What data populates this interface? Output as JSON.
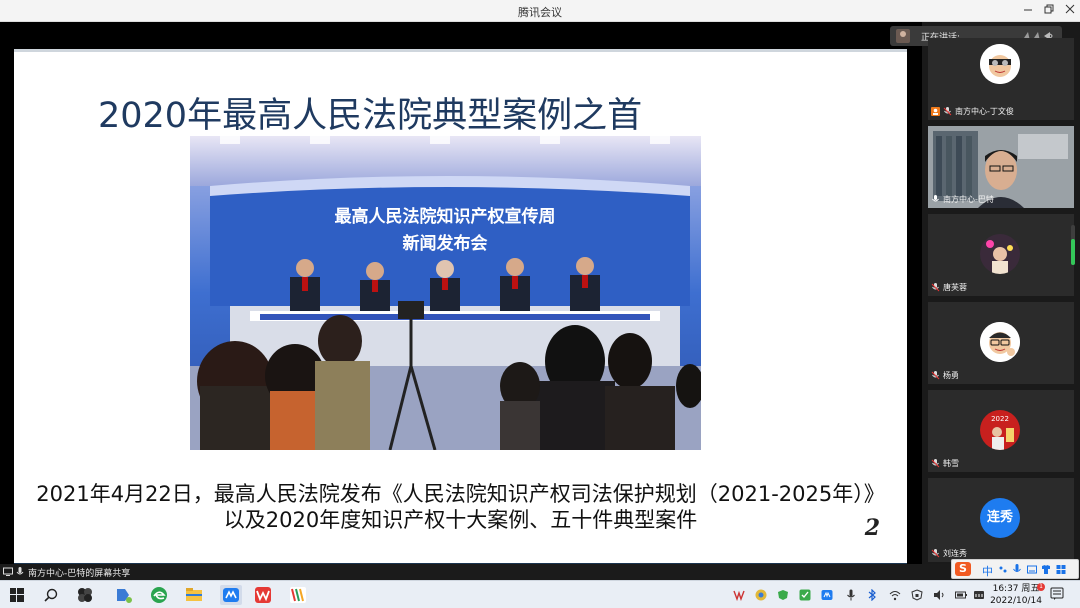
{
  "window": {
    "title": "腾讯会议"
  },
  "slide": {
    "title": "2020年最高人民法院典型案例之首",
    "photo_banner_line1": "最高人民法院知识产权宣传周",
    "photo_banner_line2": "新闻发布会",
    "caption_line1": "2021年4月22日，最高人民法院发布《人民法院知识产权司法保护规划（2021-2025年）》",
    "caption_line2": "以及2020年度知识产权十大案例、五十件典型案件",
    "page_number": "2"
  },
  "speaking": {
    "label": "正在讲话:"
  },
  "participants": [
    {
      "name": "南方中心-丁文俊",
      "avatar": "cartoon-face"
    },
    {
      "name": "南方中心-巴特",
      "avatar": "camera-video"
    },
    {
      "name": "唐芙蓉",
      "avatar": "photo"
    },
    {
      "name": "杨勇",
      "avatar": "cartoon-glasses"
    },
    {
      "name": "韩雪",
      "avatar": "photo-2022"
    },
    {
      "name": "刘连秀",
      "avatar": "text",
      "avatar_text": "连秀"
    }
  ],
  "share_status": {
    "text": "南方中心-巴特的屏幕共享"
  },
  "ime": {
    "mode": "中"
  },
  "taskbar": {
    "apps": [
      "start-icon",
      "search-icon",
      "app-icon",
      "wechat-work-icon",
      "edge-icon",
      "file-explorer-icon",
      "meeting-icon",
      "wps-icon",
      "wps-writer-icon"
    ],
    "time": "16:37 周五",
    "date": "2022/10/14",
    "notification_badge": "1"
  },
  "colors": {
    "slide_title": "#1f3a60",
    "speaking_bg": "#3a3a3a",
    "avatar_blue": "#1e7cf0",
    "ime_orange": "#f15a22"
  },
  "audio_level": 0.65
}
